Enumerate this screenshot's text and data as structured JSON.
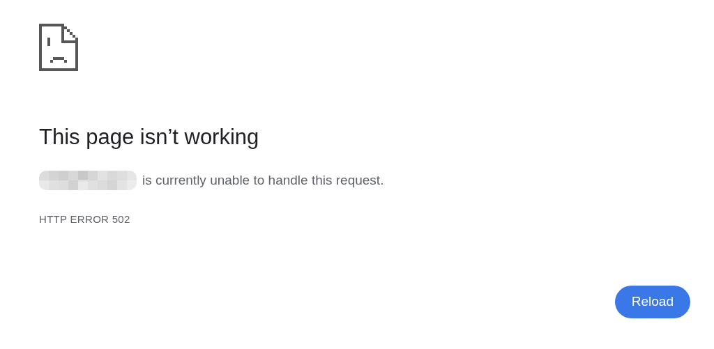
{
  "heading": "This page isn’t working",
  "message": "is currently unable to handle this request.",
  "error_code": "HTTP ERROR 502",
  "buttons": [
    {
      "label": "Reload"
    }
  ]
}
